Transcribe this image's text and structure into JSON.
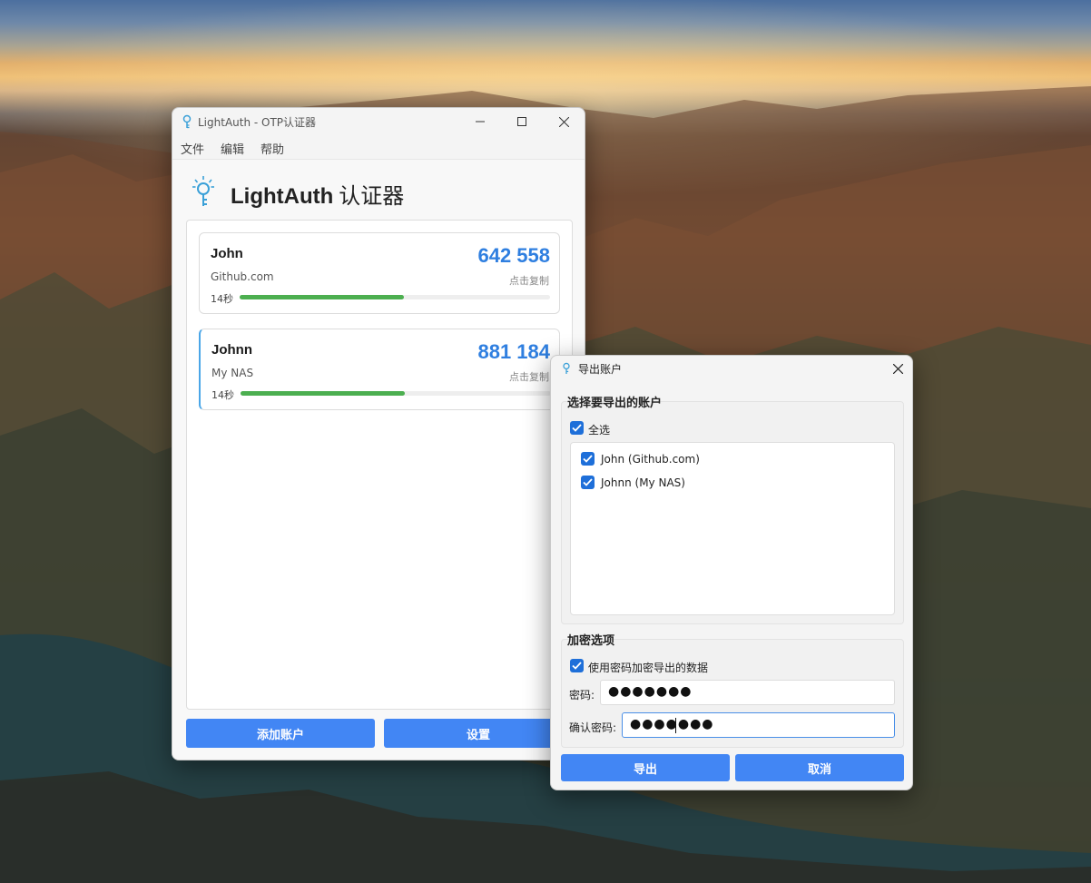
{
  "main_window": {
    "title": "LightAuth - OTP认证器",
    "menu": [
      "文件",
      "编辑",
      "帮助"
    ],
    "app_name": "LightAuth",
    "app_subtitle": "认证器",
    "accounts": [
      {
        "name": "John",
        "issuer": "Github.com",
        "code": "642 558",
        "copy_hint": "点击复制",
        "seconds_label": "14秒",
        "progress": 0.53
      },
      {
        "name": "Johnn",
        "issuer": "My NAS",
        "code": "881 184",
        "copy_hint": "点击复制",
        "seconds_label": "14秒",
        "progress": 0.53
      }
    ],
    "buttons": {
      "add": "添加账户",
      "settings": "设置"
    }
  },
  "export_dialog": {
    "title": "导出账户",
    "select_section": "选择要导出的账户",
    "select_all": "全选",
    "account_items": [
      "John (Github.com)",
      "Johnn (My NAS)"
    ],
    "encrypt_section": "加密选项",
    "encrypt_checkbox": "使用密码加密导出的数据",
    "password_label": "密码:",
    "password_value": "●●●●●●●",
    "confirm_label": "确认密码:",
    "confirm_value": "●●●●●●●",
    "export_button": "导出",
    "cancel_button": "取消"
  },
  "colors": {
    "accent": "#4286f4",
    "code": "#2f7fe0",
    "progress": "#4caf50",
    "checkbox": "#1e6fd9"
  },
  "icons": [
    "lightbulb-key-icon",
    "minimize-icon",
    "maximize-icon",
    "close-icon",
    "checkmark-icon"
  ]
}
